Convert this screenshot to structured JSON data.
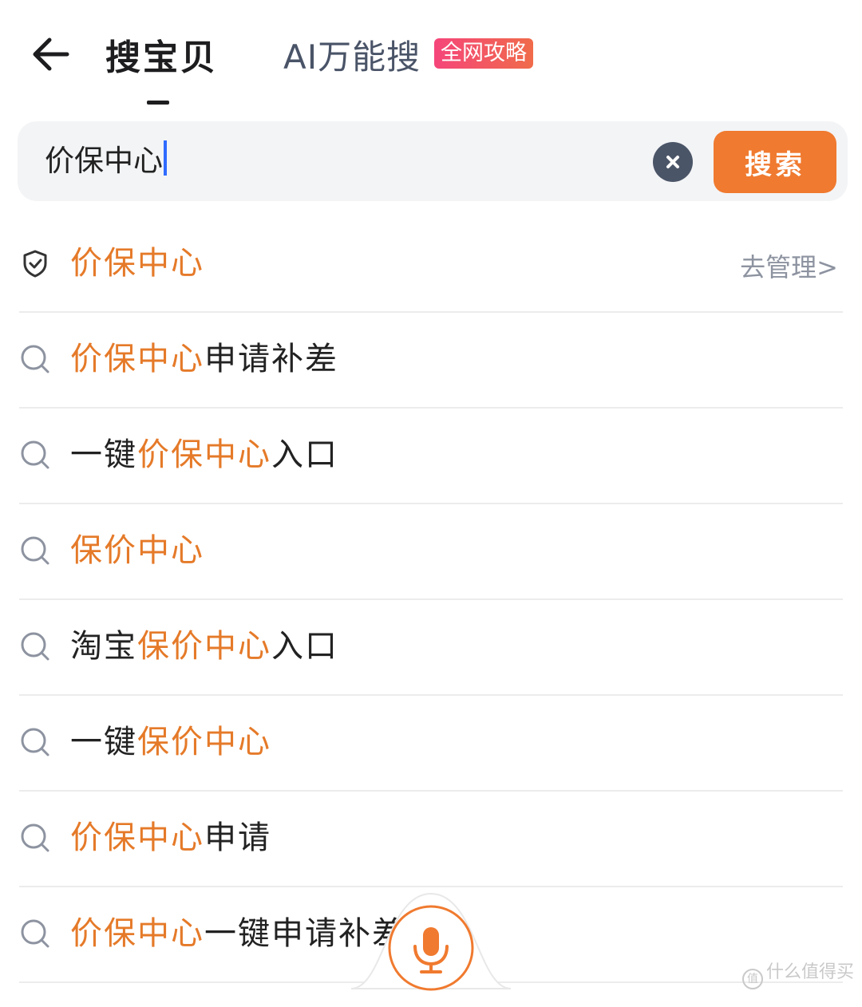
{
  "header": {
    "tab_main": "搜宝贝",
    "tab_ai": "AI万能搜",
    "tab_badge": "全网攻略"
  },
  "search": {
    "value": "价保中心",
    "button_label": "搜索"
  },
  "first_item": {
    "highlight": "价保中心",
    "manage_label": "去管理>"
  },
  "suggestions": [
    {
      "pre": "",
      "hl": "价保中心",
      "post": "申请补差"
    },
    {
      "pre": "一键",
      "hl": "价保中心",
      "post": "入口"
    },
    {
      "pre": "",
      "hl": "保价中心",
      "post": ""
    },
    {
      "pre": "淘宝",
      "hl": "保价中心",
      "post": "入口"
    },
    {
      "pre": "一键",
      "hl": "保价中心",
      "post": ""
    },
    {
      "pre": "",
      "hl": "价保中心",
      "post": "申请"
    },
    {
      "pre": "",
      "hl": "价保中心",
      "post": "一键申请补差"
    }
  ],
  "watermark": "什么值得买",
  "colors": {
    "accent": "#f07a2f",
    "highlight": "#e57a29",
    "badge_start": "#f5457a",
    "badge_end": "#f06b4a"
  },
  "icons": [
    "back-arrow-icon",
    "shield-check-icon",
    "search-icon",
    "clear-icon",
    "microphone-icon"
  ]
}
